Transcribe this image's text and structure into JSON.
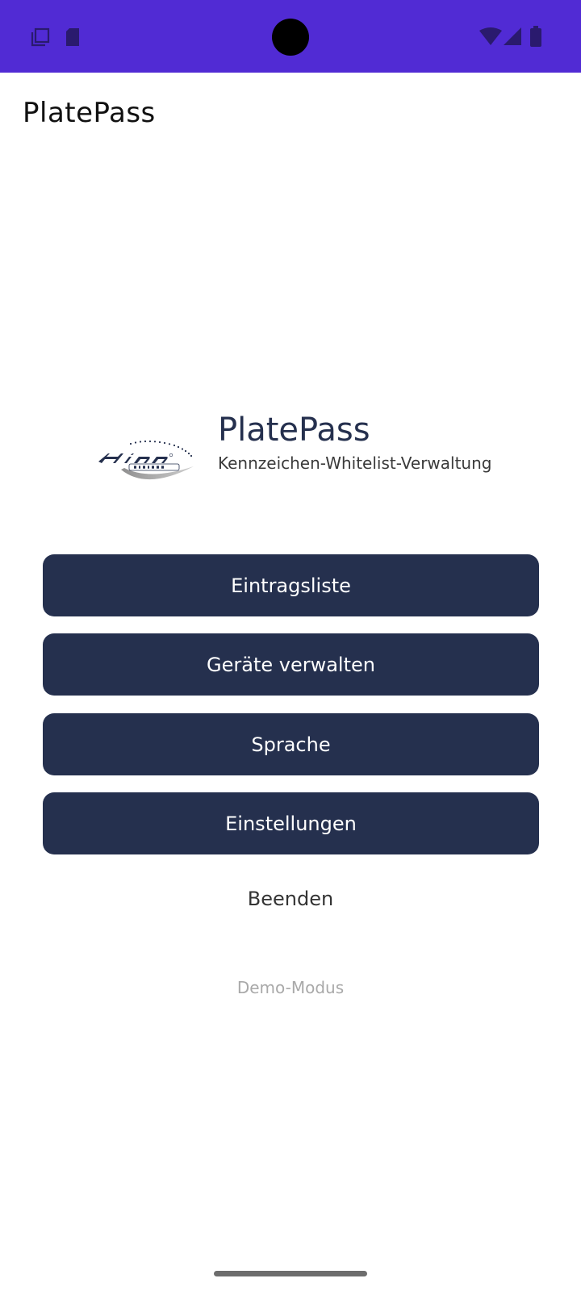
{
  "status_bar": {
    "background_color": "#512bd4",
    "left_icons": [
      "screenshot-icon",
      "sd-card-icon"
    ],
    "right_icons": [
      "wifi-icon",
      "signal-icon",
      "battery-icon"
    ]
  },
  "app_bar": {
    "title": "PlatePass"
  },
  "brand": {
    "logo_name": "hinn-visions-logo",
    "title": "PlatePass",
    "subtitle": "Kennzeichen-Whitelist-Verwaltung"
  },
  "menu": {
    "accent_color": "#25304e",
    "buttons": [
      {
        "label": "Eintragsliste"
      },
      {
        "label": "Geräte verwalten"
      },
      {
        "label": "Sprache"
      },
      {
        "label": "Einstellungen"
      }
    ],
    "exit_label": "Beenden"
  },
  "footer": {
    "mode_label": "Demo-Modus"
  }
}
